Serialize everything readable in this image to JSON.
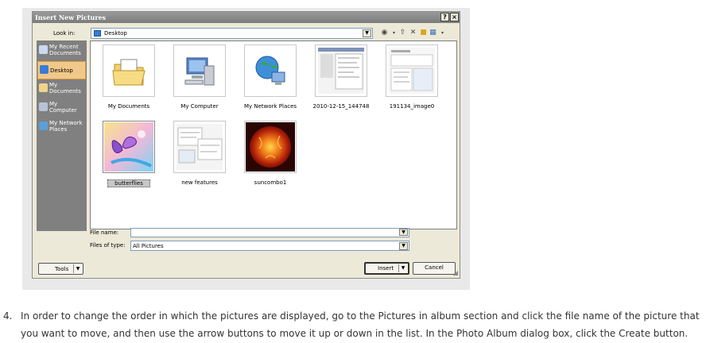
{
  "dialog": {
    "title": "Insert New Pictures",
    "title_buttons": {
      "help": "?",
      "close": "×"
    },
    "look_in_label": "Look in:",
    "look_in_value": "Desktop",
    "places": [
      {
        "label": "My Recent Documents",
        "icon": "recent-documents-icon"
      },
      {
        "label": "Desktop",
        "icon": "desktop-icon",
        "selected": true
      },
      {
        "label": "My Documents",
        "icon": "my-documents-icon"
      },
      {
        "label": "My Computer",
        "icon": "my-computer-icon"
      },
      {
        "label": "My Network Places",
        "icon": "network-places-icon"
      }
    ],
    "files": [
      {
        "name": "My Documents",
        "icon": "folder-icon"
      },
      {
        "name": "My Computer",
        "icon": "computer-icon"
      },
      {
        "name": "My Network Places",
        "icon": "network-icon"
      },
      {
        "name": "2010-12-15_144748",
        "icon": "screenshot-thumbnail"
      },
      {
        "name": "191134_image0",
        "icon": "screenshot-thumbnail"
      },
      {
        "name": "butterflies",
        "icon": "butterfly-image",
        "selected": true
      },
      {
        "name": "new features",
        "icon": "screenshot-thumbnail"
      },
      {
        "name": "suncombo1",
        "icon": "sun-image"
      }
    ],
    "file_name_label": "File name:",
    "file_name_value": "",
    "file_type_label": "Files of type:",
    "file_type_value": "All Pictures",
    "tools_label": "Tools",
    "insert_label": "Insert",
    "cancel_label": "Cancel"
  },
  "instruction": {
    "number": "4.",
    "text": "In order to change the order in which the pictures are displayed, go to the Pictures in album section and click the file name of the picture that you want to move, and then use the arrow buttons to move it up or down in the list. In the Photo Album dialog box, click the Create button."
  },
  "colors": {
    "accent": "#f2c88a",
    "places_bar": "#808080",
    "dialog_bg": "#ece9d8"
  }
}
